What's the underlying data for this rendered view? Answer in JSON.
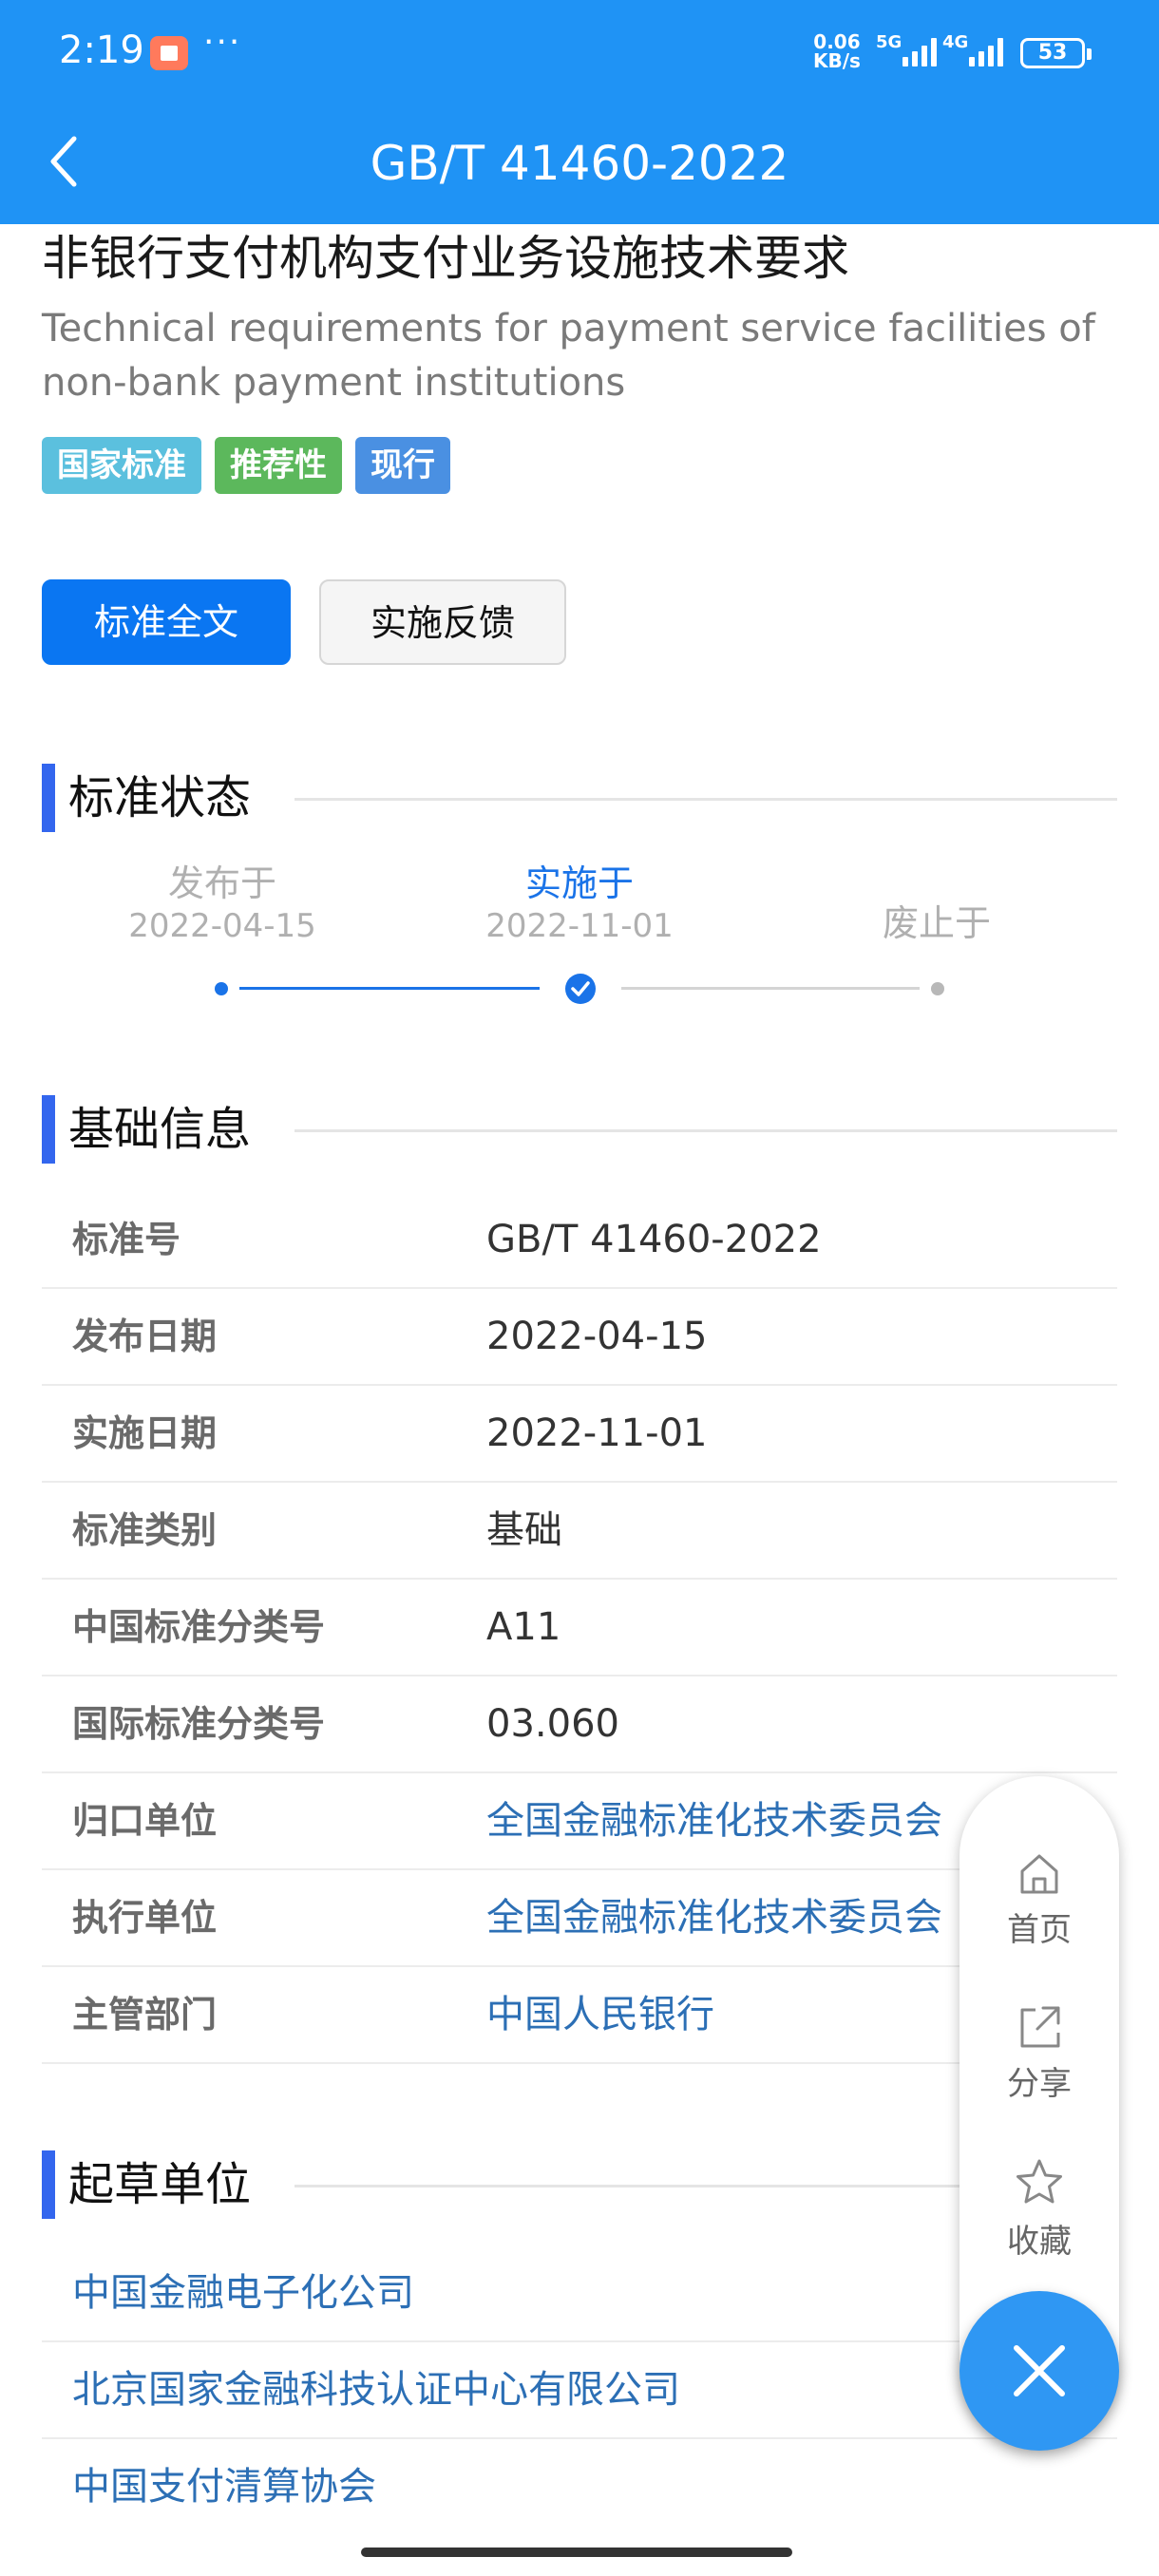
{
  "status_bar": {
    "time": "2:19",
    "more": "···",
    "net_speed_value": "0.06",
    "net_speed_unit": "KB/s",
    "sim1": "5G",
    "sim2": "4G",
    "battery": "53"
  },
  "header": {
    "title": "GB/T 41460-2022"
  },
  "standard": {
    "title_cn": "非银行支付机构支付业务设施技术要求",
    "title_en": "Technical requirements for payment service facilities of non-bank payment institutions",
    "tags": [
      {
        "label": "国家标准",
        "color": "#5bc0de"
      },
      {
        "label": "推荐性",
        "color": "#5cb85c"
      },
      {
        "label": "现行",
        "color": "#4a90e2"
      }
    ]
  },
  "actions": {
    "full_text": "标准全文",
    "feedback": "实施反馈"
  },
  "status_section": {
    "title": "标准状态",
    "steps": [
      {
        "label": "发布于",
        "date": "2022-04-15"
      },
      {
        "label": "实施于",
        "date": "2022-11-01"
      },
      {
        "label": "废止于",
        "date": ""
      }
    ],
    "active_color": "#1a73e8",
    "inactive_color": "#b0b0b0"
  },
  "basic_section": {
    "title": "基础信息",
    "rows": [
      {
        "key": "标准号",
        "value": "GB/T 41460-2022",
        "link": false
      },
      {
        "key": "发布日期",
        "value": "2022-04-15",
        "link": false
      },
      {
        "key": "实施日期",
        "value": "2022-11-01",
        "link": false
      },
      {
        "key": "标准类别",
        "value": "基础",
        "link": false
      },
      {
        "key": "中国标准分类号",
        "value": "A11",
        "link": false
      },
      {
        "key": "国际标准分类号",
        "value": "03.060",
        "link": false
      },
      {
        "key": "归口单位",
        "value": "全国金融标准化技术委员会",
        "link": true
      },
      {
        "key": "执行单位",
        "value": "全国金融标准化技术委员会",
        "link": true
      },
      {
        "key": "主管部门",
        "value": "中国人民银行",
        "link": true
      }
    ]
  },
  "drafter_section": {
    "title": "起草单位",
    "items": [
      "中国金融电子化公司",
      "北京国家金融科技认证中心有限公司",
      "中国支付清算协会"
    ]
  },
  "float_menu": {
    "home": {
      "label": "首页",
      "icon": "home-icon"
    },
    "share": {
      "label": "分享",
      "icon": "share-icon"
    },
    "favorite": {
      "label": "收藏",
      "icon": "star-icon"
    },
    "close_icon": "close-icon"
  }
}
